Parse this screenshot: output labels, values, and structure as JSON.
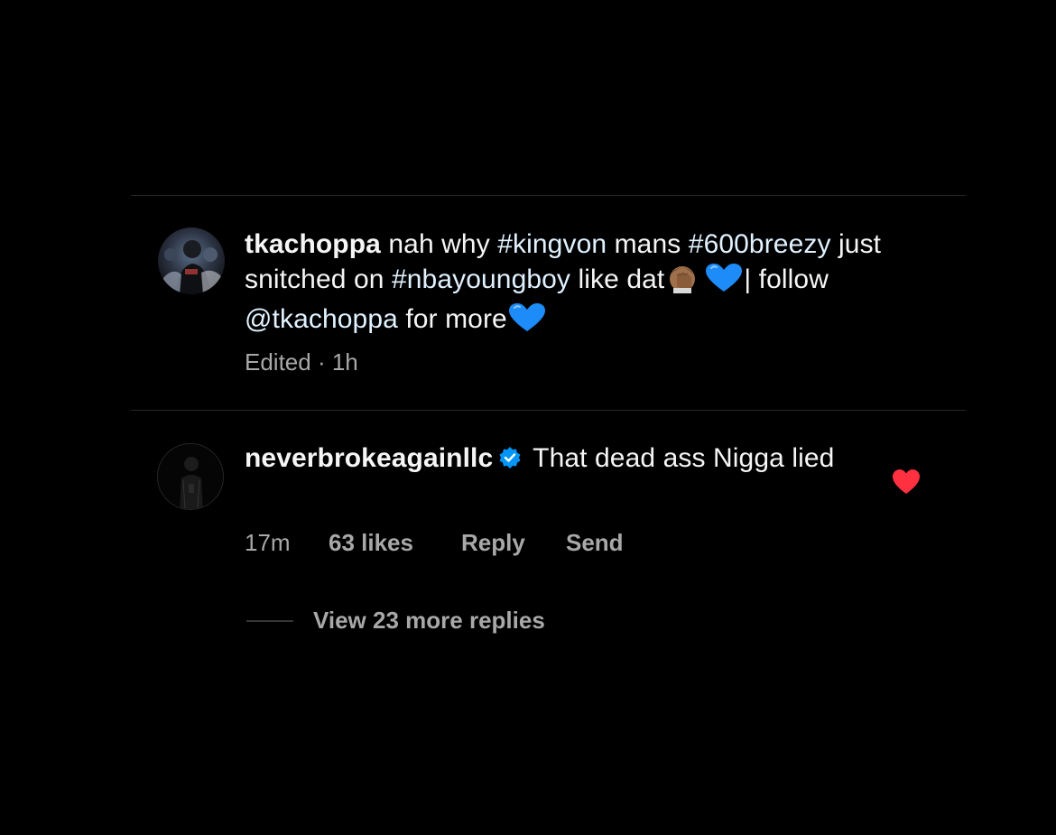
{
  "colors": {
    "background": "#000000",
    "divider": "#262626",
    "primary_text": "#f5f5f5",
    "secondary_text": "#a8a8a8",
    "link": "#e0f1ff",
    "verified_badge": "#0095f6",
    "heart": "#ff3040",
    "blue_heart_emoji": "#1d8cf8"
  },
  "post_caption": {
    "username": "tkachoppa",
    "text_1": " nah why ",
    "hashtag_1": "#kingvon",
    "text_2": " mans ",
    "hashtag_2": "#600breezy",
    "text_3": " just snitched on ",
    "hashtag_3": "#nbayoungboy",
    "text_4": " like dat",
    "emoji_1": "facepalm-emoji",
    "emoji_2": "blue-heart-emoji",
    "text_5": "| follow ",
    "mention": "@tkachoppa",
    "text_6": " for more",
    "emoji_3": "blue-heart-emoji",
    "meta": "Edited · 1h"
  },
  "comment": {
    "username": "neverbrokeagainllc",
    "verified": true,
    "text": " That dead ass Nigga lied",
    "time": "17m",
    "likes": "63 likes",
    "reply_label": "Reply",
    "send_label": "Send",
    "liked": true,
    "view_replies": "View 23 more replies"
  }
}
